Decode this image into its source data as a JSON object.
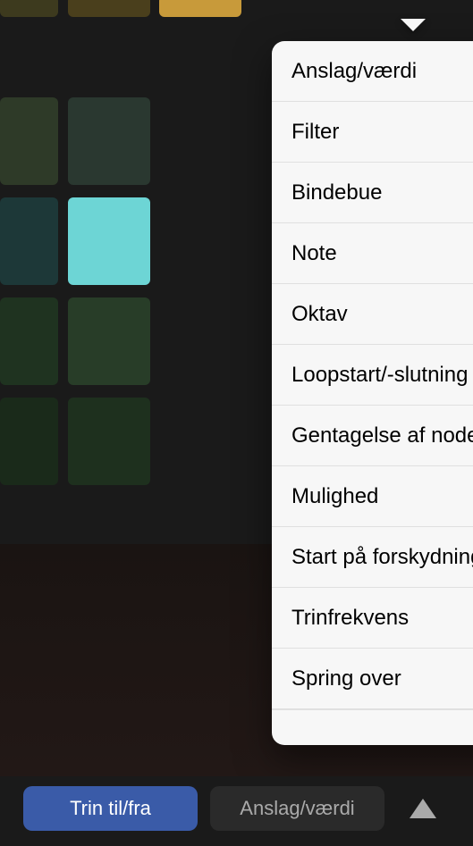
{
  "menu": {
    "items": [
      {
        "label": "Anslag/værdi",
        "selected": true
      },
      {
        "label": "Filter",
        "selected": false
      },
      {
        "label": "Bindebue",
        "selected": false
      },
      {
        "label": "Note",
        "selected": false
      },
      {
        "label": "Oktav",
        "selected": false
      },
      {
        "label": "Loopstart/-slutning",
        "selected": false
      },
      {
        "label": "Gentagelse af node",
        "selected": false
      },
      {
        "label": "Mulighed",
        "selected": false
      },
      {
        "label": "Start på forskydning",
        "selected": false
      },
      {
        "label": "Trinfrekvens",
        "selected": false
      },
      {
        "label": "Spring over",
        "selected": false
      }
    ]
  },
  "toolbar": {
    "stepToggle": "Trin til/fra",
    "velocityValue": "Anslag/værdi"
  },
  "grid": {
    "highlightColor": "#6dd5d5",
    "accentColor": "#c89a3a"
  }
}
